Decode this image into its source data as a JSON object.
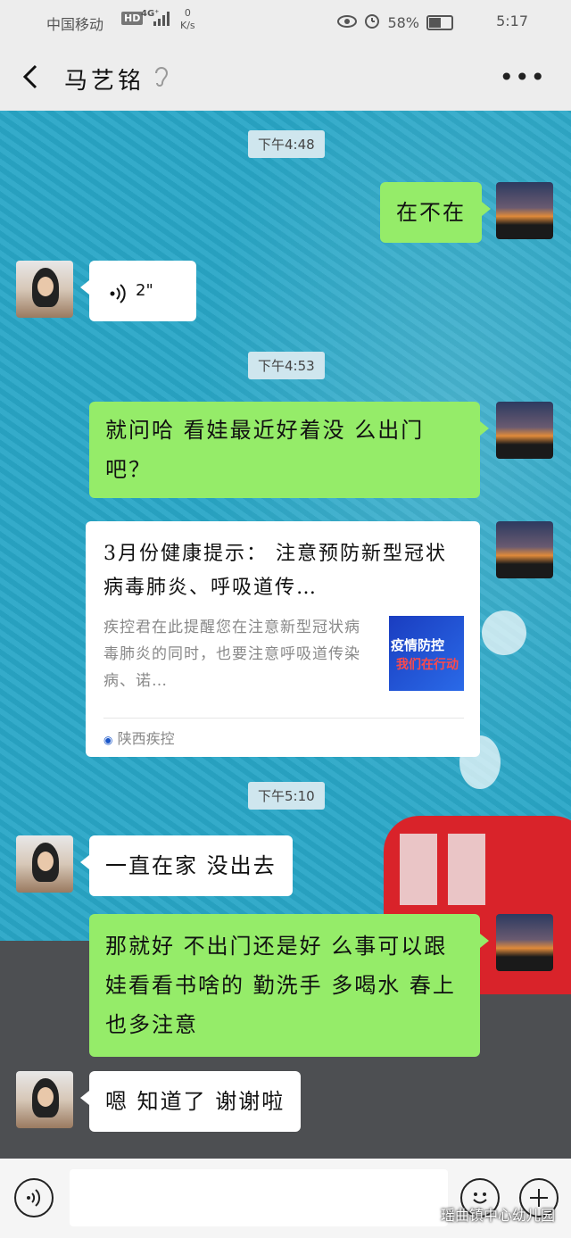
{
  "status_bar": {
    "carrier": "中国移动",
    "hd": "HD",
    "network": "4G⁺",
    "speed_value": "0",
    "speed_unit": "K/s",
    "battery": "58%",
    "battery_level": 0.58,
    "time": "5:17"
  },
  "header": {
    "contact_name": "马艺铭",
    "back_icon": "chevron-left-icon",
    "more_icon": "more-dots-icon"
  },
  "messages": {
    "ts1": "下午4:48",
    "m1": "在不在",
    "m2_duration": "2\"",
    "ts2": "下午4:53",
    "m3": "就问哈 看娃最近好着没 么出门吧？",
    "card": {
      "title": "3月份健康提示： 注意预防新型冠状病毒肺炎、呼吸道传…",
      "desc": "疾控君在此提醒您在注意新型冠状病毒肺炎的同时，也要注意呼吸道传染病、诺…",
      "thumb_line1": "疫情防控",
      "thumb_line2": "我们在行动",
      "source": "陕西疾控"
    },
    "ts3": "下午5:10",
    "m4": "一直在家 没出去",
    "m5": "那就好 不出门还是好 么事可以跟娃看看书啥的 勤洗手 多喝水 春上也多注意",
    "m6": "嗯 知道了 谢谢啦"
  },
  "input_bar": {
    "voice_icon": "voice-icon",
    "emoji_icon": "emoji-icon",
    "plus_icon": "plus-icon",
    "watermark": "瑶曲镇中心幼儿园"
  }
}
